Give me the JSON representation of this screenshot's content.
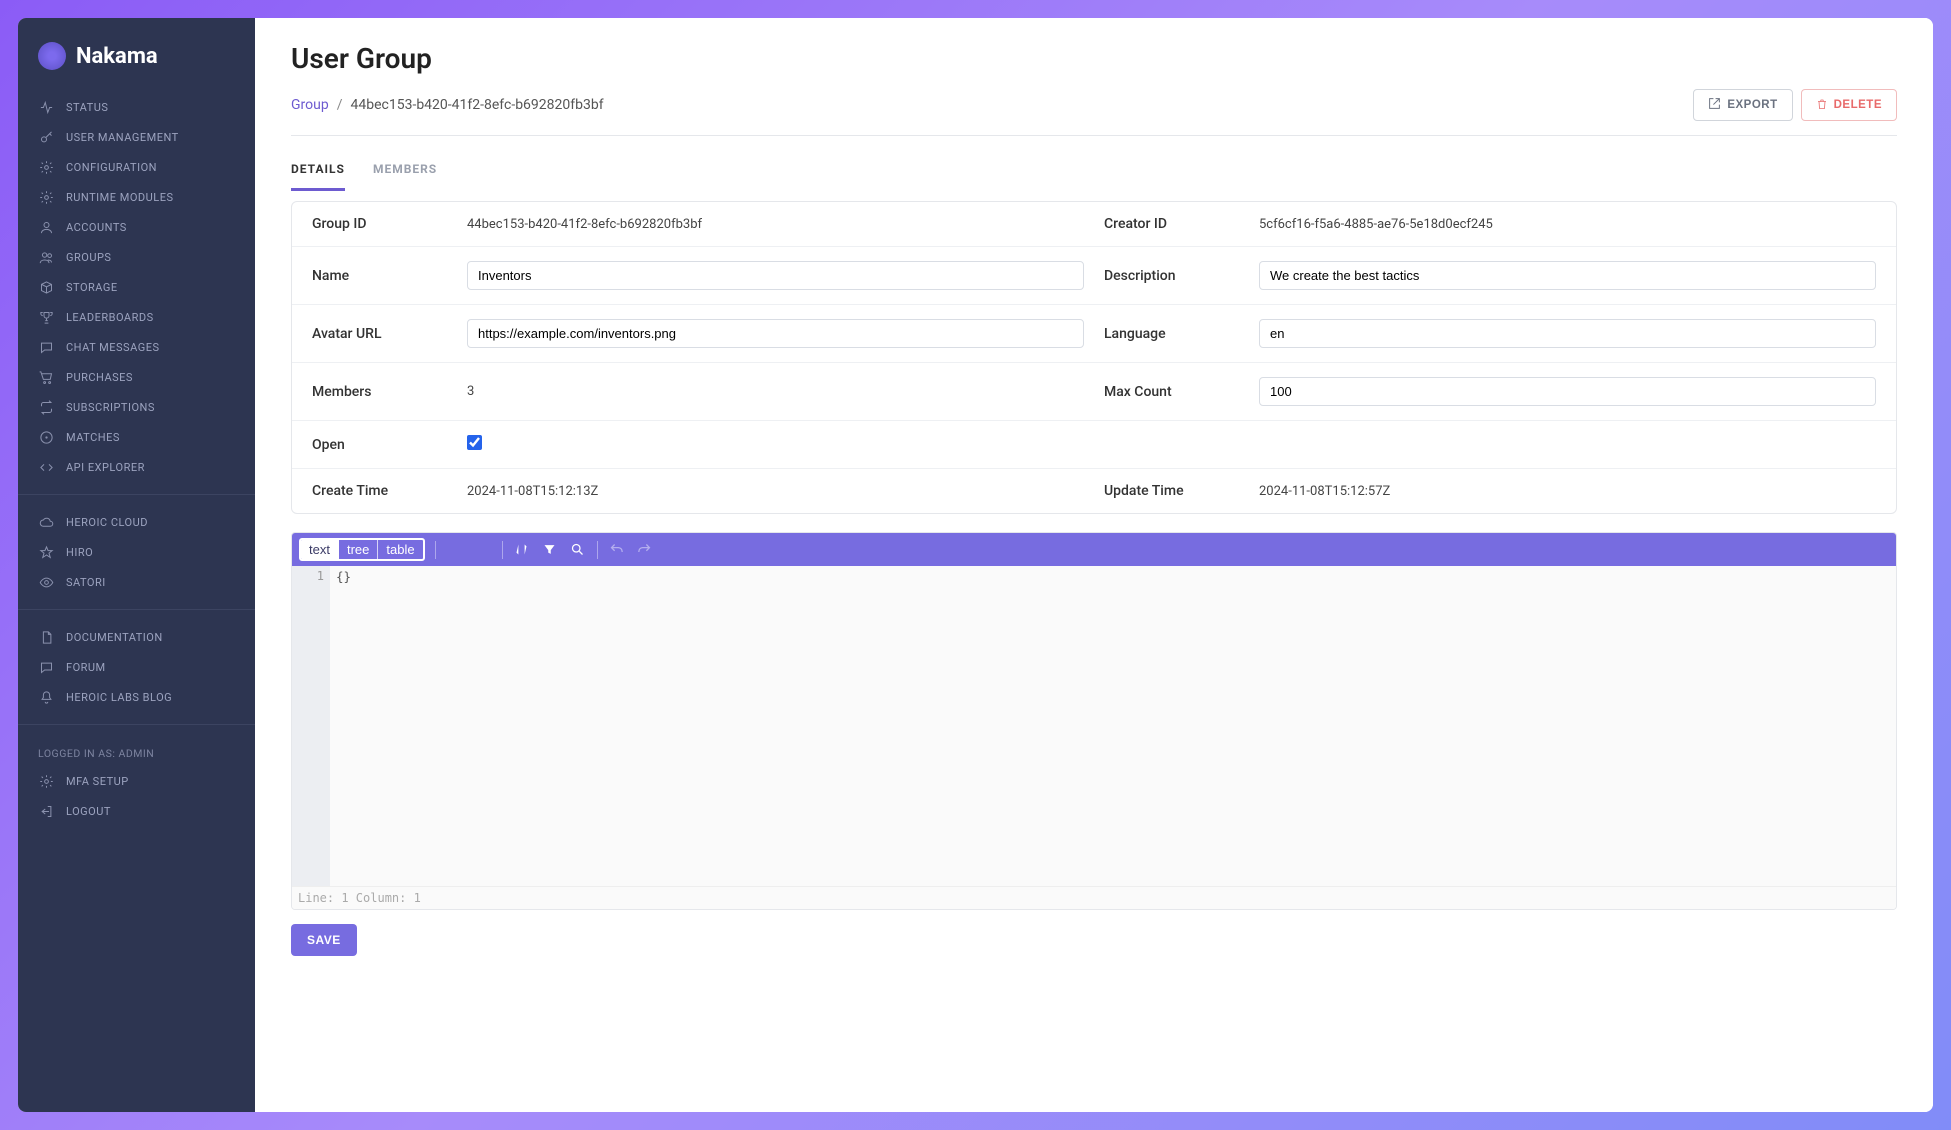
{
  "brand": {
    "name": "Nakama"
  },
  "sidebar": {
    "main": [
      {
        "label": "Status",
        "icon": "activity"
      },
      {
        "label": "User Management",
        "icon": "key"
      },
      {
        "label": "Configuration",
        "icon": "gear"
      },
      {
        "label": "Runtime Modules",
        "icon": "gear"
      },
      {
        "label": "Accounts",
        "icon": "user"
      },
      {
        "label": "Groups",
        "icon": "users"
      },
      {
        "label": "Storage",
        "icon": "box"
      },
      {
        "label": "Leaderboards",
        "icon": "trophy"
      },
      {
        "label": "Chat Messages",
        "icon": "chat"
      },
      {
        "label": "Purchases",
        "icon": "cart"
      },
      {
        "label": "Subscriptions",
        "icon": "repeat"
      },
      {
        "label": "Matches",
        "icon": "swords"
      },
      {
        "label": "API Explorer",
        "icon": "code"
      }
    ],
    "cloud": [
      {
        "label": "Heroic Cloud",
        "icon": "cloud"
      },
      {
        "label": "Hiro",
        "icon": "star"
      },
      {
        "label": "Satori",
        "icon": "eye"
      }
    ],
    "docs": [
      {
        "label": "Documentation",
        "icon": "page"
      },
      {
        "label": "Forum",
        "icon": "chat"
      },
      {
        "label": "Heroic Labs Blog",
        "icon": "bell"
      }
    ],
    "logged_in_label": "Logged in as: Admin",
    "account": [
      {
        "label": "MFA Setup",
        "icon": "gear"
      },
      {
        "label": "Logout",
        "icon": "logout"
      }
    ]
  },
  "page": {
    "title": "User Group",
    "breadcrumb": {
      "root": "Group",
      "id": "44bec153-b420-41f2-8efc-b692820fb3bf"
    },
    "actions": {
      "export": "EXPORT",
      "delete": "DELETE"
    },
    "tabs": {
      "details": "DETAILS",
      "members": "MEMBERS"
    }
  },
  "details": {
    "group_id_label": "Group ID",
    "group_id": "44bec153-b420-41f2-8efc-b692820fb3bf",
    "creator_id_label": "Creator ID",
    "creator_id": "5cf6cf16-f5a6-4885-ae76-5e18d0ecf245",
    "name_label": "Name",
    "name": "Inventors",
    "description_label": "Description",
    "description": "We create the best tactics",
    "avatar_label": "Avatar URL",
    "avatar_url": "https://example.com/inventors.png",
    "language_label": "Language",
    "language": "en",
    "members_label": "Members",
    "members": "3",
    "maxcount_label": "Max Count",
    "maxcount": "100",
    "open_label": "Open",
    "open": true,
    "create_label": "Create Time",
    "create_time": "2024-11-08T15:12:13Z",
    "update_label": "Update Time",
    "update_time": "2024-11-08T15:12:57Z"
  },
  "editor": {
    "modes": {
      "text": "text",
      "tree": "tree",
      "table": "table",
      "active": "text"
    },
    "gutter": "1",
    "content": "{}",
    "status": "Line: 1  Column: 1"
  },
  "save_label": "SAVE"
}
